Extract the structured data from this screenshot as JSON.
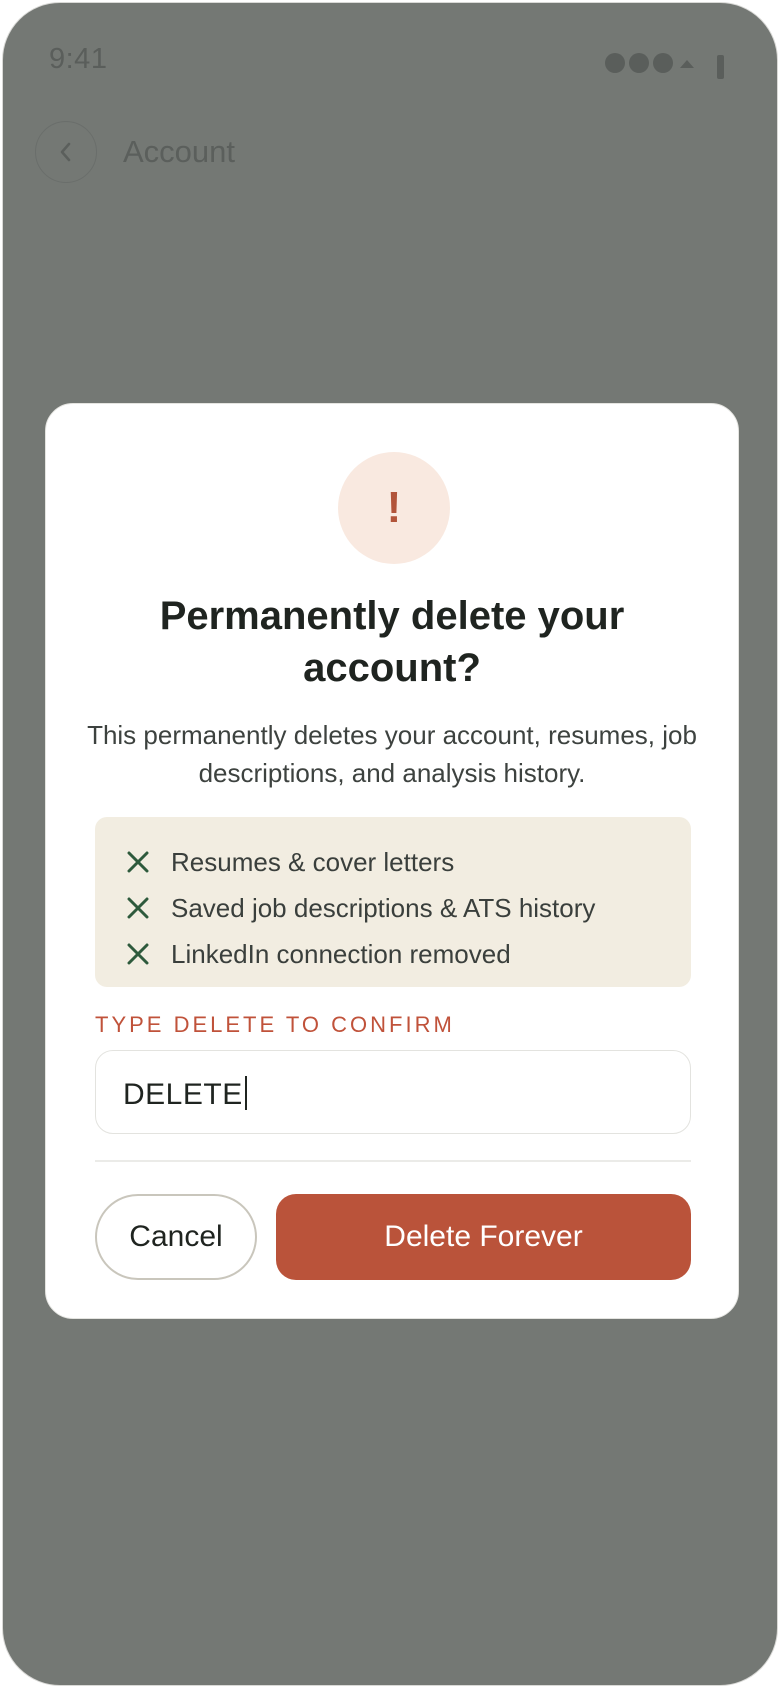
{
  "status_bar": {
    "time": "9:41"
  },
  "header": {
    "back_icon": "chevron-left-icon",
    "title": "Account"
  },
  "dialog": {
    "icon": "exclamation-icon",
    "icon_glyph": "!",
    "title": "Permanently delete your account?",
    "description": "This permanently deletes your account, resumes, job descriptions, and analysis history.",
    "consequences": [
      {
        "icon": "x-icon",
        "label": "Resumes & cover letters"
      },
      {
        "icon": "x-icon",
        "label": "Saved job descriptions & ATS history"
      },
      {
        "icon": "x-icon",
        "label": "LinkedIn connection removed"
      }
    ],
    "confirm_label": "TYPE DELETE TO CONFIRM",
    "confirm_value": "DELETE",
    "cancel_label": "Cancel",
    "delete_label": "Delete Forever"
  },
  "colors": {
    "backdrop": "#747874",
    "danger": "#ba533a",
    "warning_bg": "#f9e9e0",
    "consequence_bg": "#f2ede1",
    "x_icon": "#2e5a3c"
  }
}
